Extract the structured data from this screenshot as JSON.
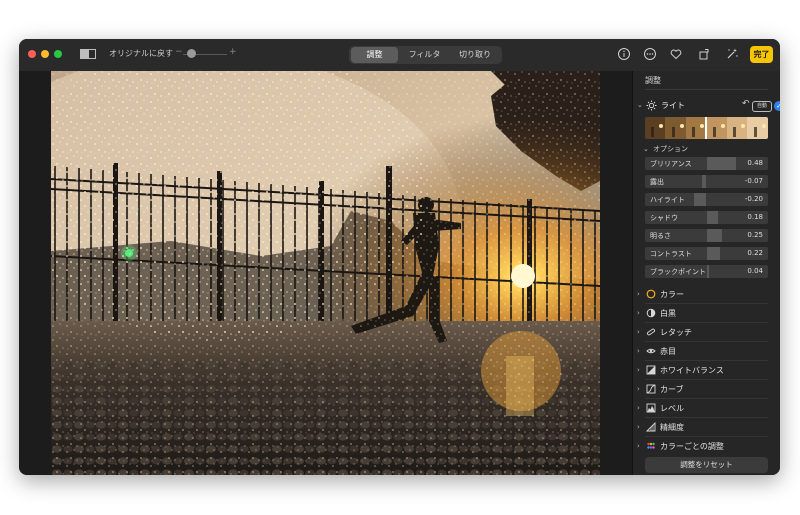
{
  "toolbar": {
    "revert_label": "オリジナルに戻す",
    "zoom_minus": "−",
    "zoom_plus": "+",
    "zoom_level": 0.1,
    "tabs": [
      {
        "label": "調整",
        "selected": true
      },
      {
        "label": "フィルタ",
        "selected": false
      },
      {
        "label": "切り取り",
        "selected": false
      }
    ],
    "icons": [
      "info-icon",
      "more-icon",
      "heart-icon",
      "rotate-icon",
      "magic-wand-icon"
    ],
    "done_label": "完了"
  },
  "sidebar": {
    "title": "調整",
    "light": {
      "label": "ライト",
      "undo_glyph": "↶",
      "auto_label": "自動",
      "check_glyph": "✓"
    },
    "options_label": "オプション",
    "sliders": [
      {
        "name": "ブリリアンス",
        "value": "0.48",
        "level": 0.48
      },
      {
        "name": "露出",
        "value": "-0.07",
        "level": -0.07
      },
      {
        "name": "ハイライト",
        "value": "-0.20",
        "level": -0.2
      },
      {
        "name": "シャドウ",
        "value": "0.18",
        "level": 0.18
      },
      {
        "name": "明るさ",
        "value": "0.25",
        "level": 0.25
      },
      {
        "name": "コントラスト",
        "value": "0.22",
        "level": 0.22
      },
      {
        "name": "ブラックポイント",
        "value": "0.04",
        "level": 0.04
      }
    ],
    "sections": [
      {
        "label": "カラー",
        "icon": "color-circle-icon"
      },
      {
        "label": "白黒",
        "icon": "half-circle-icon"
      },
      {
        "label": "レタッチ",
        "icon": "bandage-icon"
      },
      {
        "label": "赤目",
        "icon": "eye-icon"
      },
      {
        "label": "ホワイトバランス",
        "icon": "white-balance-icon"
      },
      {
        "label": "カーブ",
        "icon": "curve-icon"
      },
      {
        "label": "レベル",
        "icon": "levels-icon"
      },
      {
        "label": "精細度",
        "icon": "triangle-icon"
      },
      {
        "label": "カラーごとの調整",
        "icon": "color-dots-icon"
      }
    ],
    "reset_label": "調整をリセット"
  },
  "colors": {
    "accent": "#f7c600",
    "check": "#2f80ed",
    "window_bg": "#1f1f1f"
  }
}
